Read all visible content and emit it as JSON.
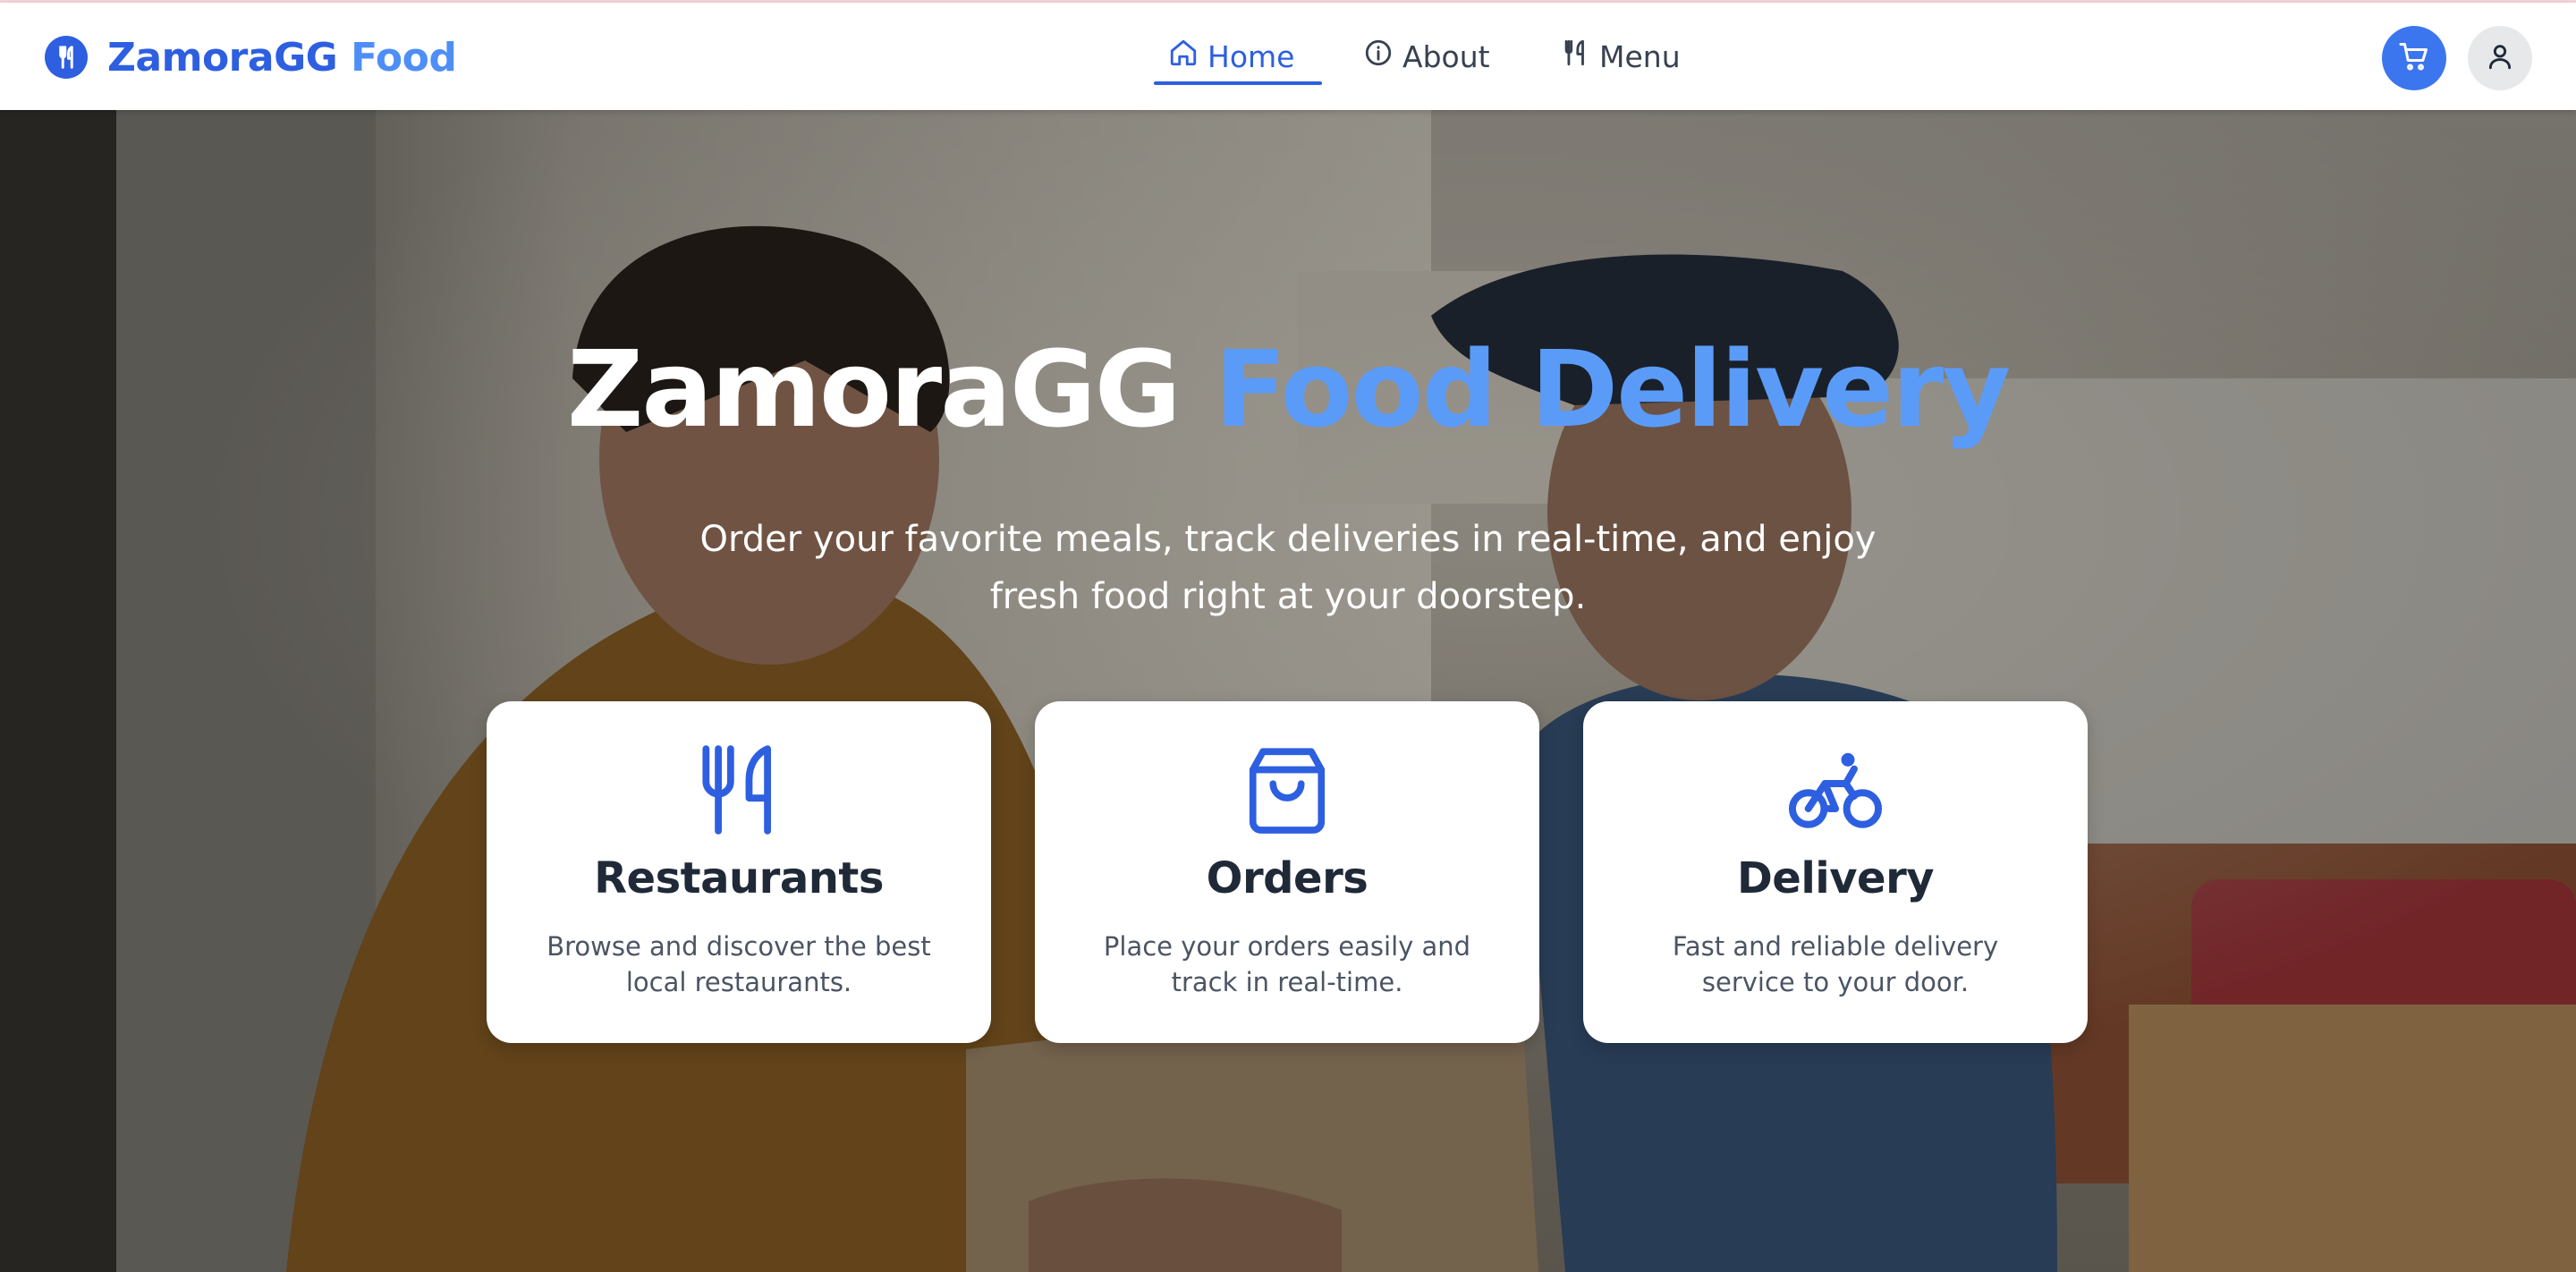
{
  "brand": {
    "name_part1": "ZamoraGG",
    "name_part2": "Food",
    "logo_icon": "utensils-icon"
  },
  "nav": {
    "items": [
      {
        "label": "Home",
        "icon": "home-icon",
        "active": true
      },
      {
        "label": "About",
        "icon": "info-icon",
        "active": false
      },
      {
        "label": "Menu",
        "icon": "utensils-icon",
        "active": false
      }
    ]
  },
  "header_actions": {
    "cart_icon": "cart-icon",
    "user_icon": "user-icon"
  },
  "hero": {
    "title_part1": "ZamoraGG",
    "title_part2": "Food Delivery",
    "subtitle": "Order your favorite meals, track deliveries in real-time, and enjoy fresh food right at your doorstep."
  },
  "features": [
    {
      "title": "Restaurants",
      "description": "Browse and discover the best local restaurants.",
      "icon": "utensils-icon"
    },
    {
      "title": "Orders",
      "description": "Place your orders easily and track in real-time.",
      "icon": "shopping-bag-icon"
    },
    {
      "title": "Delivery",
      "description": "Fast and reliable delivery service to your door.",
      "icon": "bike-icon"
    }
  ],
  "colors": {
    "primary": "#2d5fe0",
    "primary_light": "#4e8ef7",
    "cart_button": "#3b76ef",
    "text_dark": "#1f2937"
  }
}
